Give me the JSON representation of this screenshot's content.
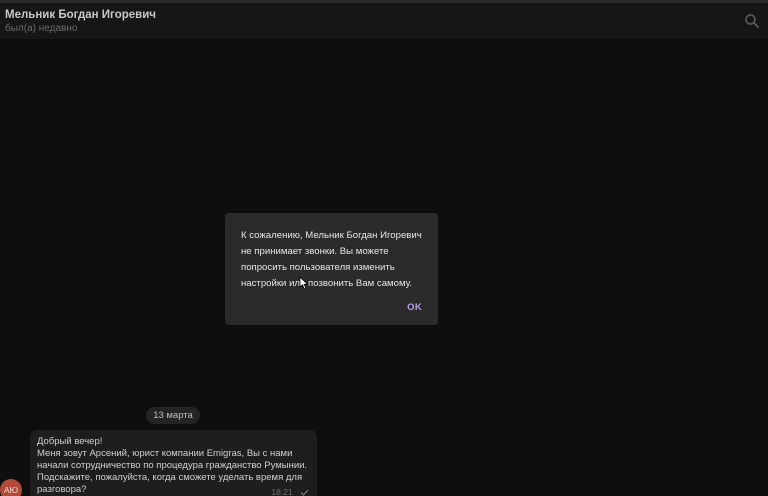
{
  "header": {
    "contact_name": "Мельник Богдан Игоревич",
    "status": "был(а) недавно",
    "search_icon": "search-icon"
  },
  "dialog": {
    "message": "К сожалению, Мельник Богдан Игоревич не принимает звонки. Вы можете попросить пользователя изменить настройки или позвонить Вам самому.",
    "ok_label": "OK"
  },
  "chat": {
    "date_label": "13 марта",
    "avatar_initials": "АЮ",
    "avatar_color": "#b24a3c",
    "message": {
      "line1": "Добрый вечер!",
      "line2": "Меня зовут Арсений, юрист компании  Emigras, Вы с нами начали сотрудничество по процедура гражданство Румынии.",
      "line3": "Подскажите, пожалуйста, когда сможете уделать время для разговора?",
      "time": "18:21"
    }
  },
  "colors": {
    "background": "#0e0e0e",
    "dialog_bg": "#2b2b2b",
    "accent": "#b6a0e8"
  }
}
